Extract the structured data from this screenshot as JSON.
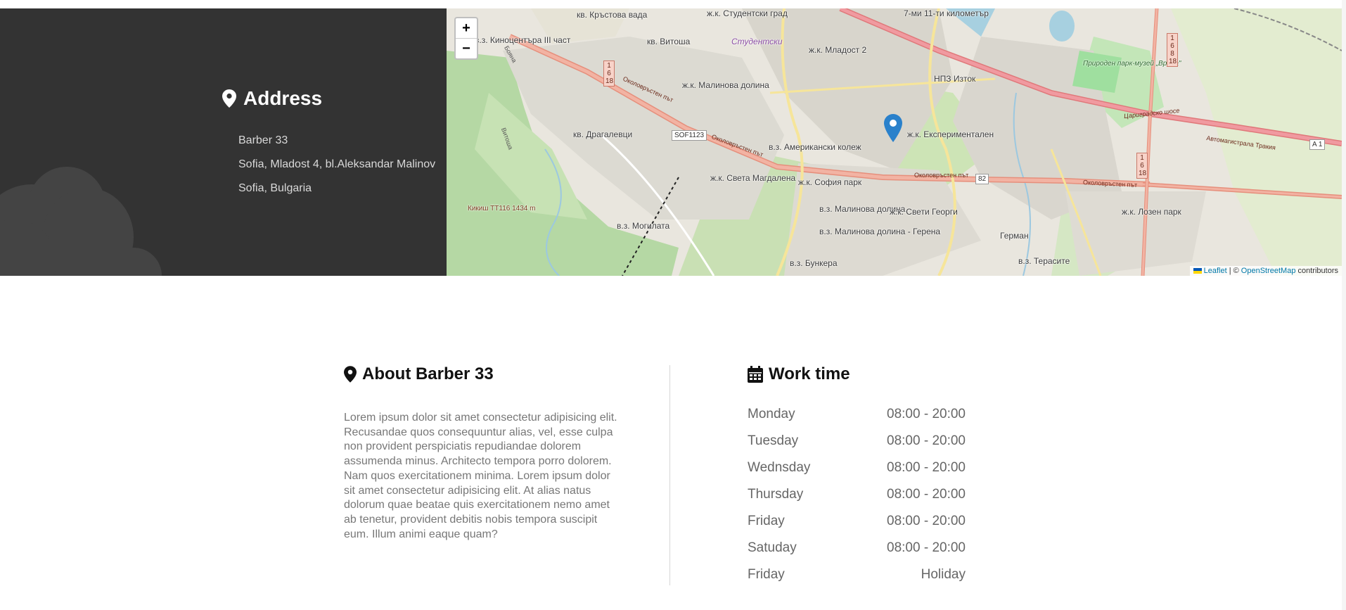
{
  "address": {
    "heading": "Address",
    "lines": [
      "Barber 33",
      "Sofia, Mladost 4, bl.Aleksandar Malinov",
      "Sofia, Bulgaria"
    ],
    "colors": {
      "panel": "#333333",
      "heading": "#ffffff",
      "text": "#d9d9d9"
    }
  },
  "map": {
    "zoom_in_label": "+",
    "zoom_out_label": "−",
    "labels": [
      "кв. Кръстова вада",
      "ж.к. Студентски град",
      "Студентски",
      "7-ми 11-ти километър",
      "в.з. Киноцентъра III част",
      "кв. Витоша",
      "ж.к. Младост 2",
      "НПЗ Изток",
      "ж.к. Малинова долина",
      "кв. Драгалевци",
      "ж.к. Експериментален",
      "Природен парк-музей „Врана\"",
      "в.з. Американски колеж",
      "ж.к. Света Магдалена",
      "ж.к. София парк",
      "в.з. Малинова долина",
      "в.з. Малинова долина - Герена",
      "ж.к. Свети Георги",
      "ж.к. Лозен парк",
      "в.з. Могилата",
      "Герман",
      "в.з. Терасите",
      "в.з. Бункера",
      "Кикиш ТТ116 1434 m"
    ],
    "road_labels": [
      "Околовръстен път",
      "Околовръстен път",
      "Околовръстен път",
      "Околовръстен път",
      "Цариградско шосе",
      "Автомагистрала Тракия",
      "Бояна",
      "Витоша"
    ],
    "shields": [
      "1 6 18",
      "1 6 8 18",
      "1 6 18"
    ],
    "badges": [
      "SOF1123",
      "82",
      "A 1"
    ],
    "attribution": {
      "leaflet": "Leaflet",
      "separator": "| ©",
      "osm": "OpenStreetMap",
      "suffix": "contributors"
    },
    "marker_color": "#2a81cb"
  },
  "about": {
    "heading": "About Barber 33",
    "text": "Lorem ipsum dolor sit amet consectetur adipisicing elit. Recusandae quos consequuntur alias, vel, esse culpa non provident perspiciatis repudiandae dolorem assumenda minus. Architecto tempora porro dolorem. Nam quos exercitationem minima. Lorem ipsum dolor sit amet consectetur adipisicing elit. At alias natus dolorum quae beatae quis exercitationem nemo amet ab tenetur, provident debitis nobis tempora suscipit eum. Illum animi eaque quam?"
  },
  "worktime": {
    "heading": "Work time",
    "rows": [
      {
        "day": "Monday",
        "hours": "08:00 - 20:00"
      },
      {
        "day": "Tuesday",
        "hours": "08:00 - 20:00"
      },
      {
        "day": "Wednsday",
        "hours": "08:00 - 20:00"
      },
      {
        "day": "Thursday",
        "hours": "08:00 - 20:00"
      },
      {
        "day": "Friday",
        "hours": "08:00 - 20:00"
      },
      {
        "day": "Satuday",
        "hours": "08:00 - 20:00"
      },
      {
        "day": "Friday",
        "hours": "Holiday"
      }
    ]
  }
}
